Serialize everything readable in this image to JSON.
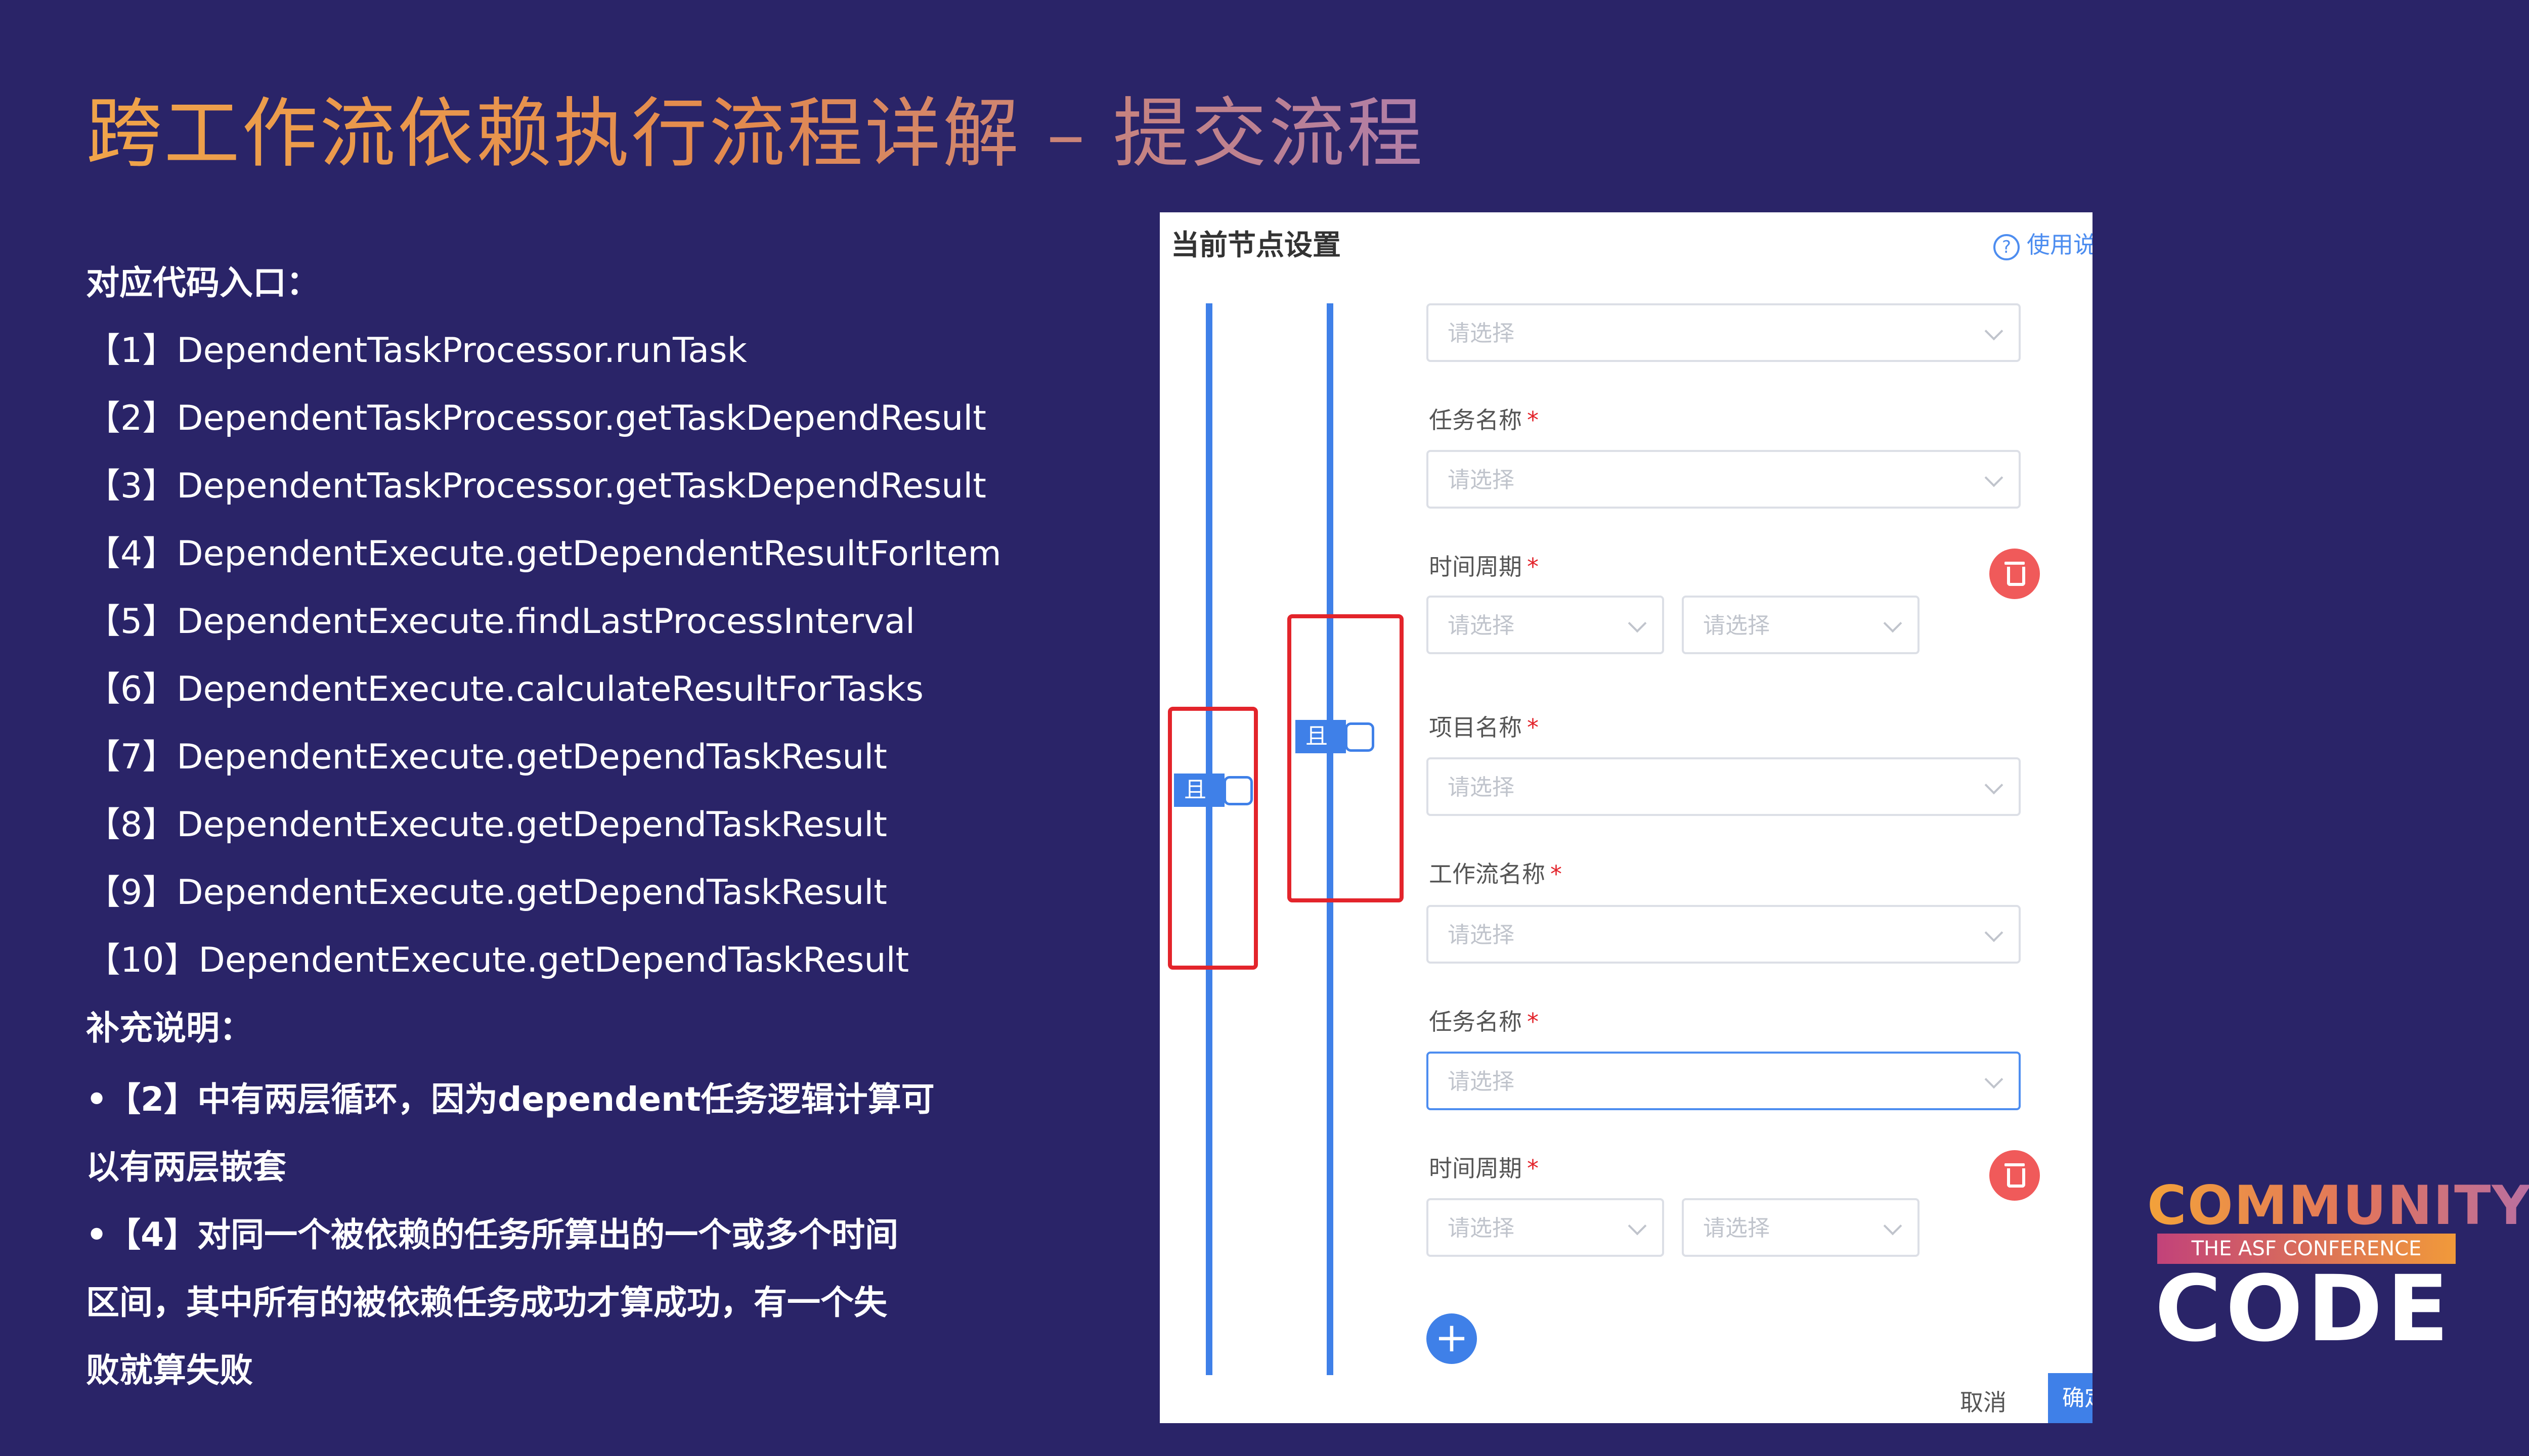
{
  "slide": {
    "title": "跨工作流依赖执行流程详解 – 提交流程",
    "code_heading": "对应代码入口：",
    "entries": [
      "【1】DependentTaskProcessor.runTask",
      "【2】DependentTaskProcessor.getTaskDependResult",
      "【3】DependentTaskProcessor.getTaskDependResult",
      "【4】DependentExecute.getDependentResultForItem",
      "【5】DependentExecute.findLastProcessInterval",
      "【6】DependentExecute.calculateResultForTasks",
      "【7】DependentExecute.getDependTaskResult",
      "【8】DependentExecute.getDependTaskResult",
      "【9】DependentExecute.getDependTaskResult",
      "【10】DependentExecute.getDependTaskResult"
    ],
    "notes_heading": "补充说明：",
    "note_lines": [
      "•【2】中有两层循环，因为dependent任务逻辑计算可",
      "以有两层嵌套",
      "•【4】对同一个被依赖的任务所算出的一个或多个时间",
      "区间，其中所有的被依赖任务成功才算成功，有一个失",
      "败就算失败"
    ]
  },
  "panel": {
    "title": "当前节点设置",
    "help_label": "使用说明",
    "and_label": "且",
    "required_mark": "*",
    "placeholder": "请选择",
    "labels": {
      "task_name": "任务名称",
      "time_period": "时间周期",
      "project_name": "项目名称",
      "workflow_name": "工作流名称"
    },
    "add_symbol": "+",
    "cancel_label": "取消",
    "confirm_label": "确定"
  },
  "logo": {
    "community": "COMMUNITY",
    "tagline": "THE ASF CONFERENCE",
    "code": "CODE"
  },
  "colors": {
    "background": "#2a2468",
    "title_gradient": [
      "#f0a44a",
      "#b07ea8"
    ],
    "panel_accent": "#3f80e8",
    "highlight": "#e3242b",
    "delete": "#f05a5a"
  }
}
